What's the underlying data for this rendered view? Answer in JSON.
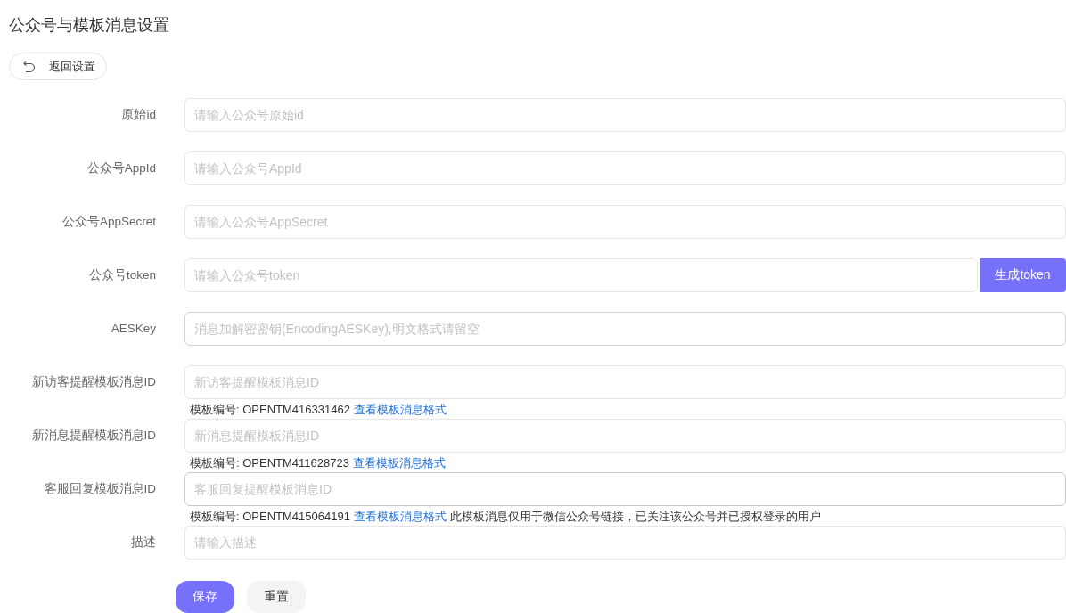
{
  "title": "公众号与模板消息设置",
  "back_button": {
    "label": "返回设置"
  },
  "fields": [
    {
      "label": "原始id",
      "placeholder": "请输入公众号原始id",
      "hovered": false,
      "focused": false
    },
    {
      "label": "公众号AppId",
      "placeholder": "请输入公众号AppId",
      "hovered": false,
      "focused": false
    },
    {
      "label": "公众号AppSecret",
      "placeholder": "请输入公众号AppSecret",
      "hovered": false,
      "focused": false
    },
    {
      "label": "公众号token",
      "placeholder": "请输入公众号token",
      "hovered": false,
      "focused": false,
      "button": "生成token"
    },
    {
      "label": "AESKey",
      "placeholder": "消息加解密密钥(EncodingAESKey),明文格式请留空",
      "hovered": true,
      "focused": false
    },
    {
      "label": "新访客提醒模板消息ID",
      "placeholder": "新访客提醒模板消息ID",
      "hovered": false,
      "focused": false,
      "hint": {
        "code": "模板编号: OPENTM416331462",
        "link": "查看模板消息格式"
      }
    },
    {
      "label": "新消息提醒模板消息ID",
      "placeholder": "新消息提醒模板消息ID",
      "hovered": false,
      "focused": false,
      "hint": {
        "code": "模板编号: OPENTM411628723",
        "link": "查看模板消息格式"
      }
    },
    {
      "label": "客服回复模板消息ID",
      "placeholder": "客服回复提醒模板消息ID",
      "hovered": false,
      "focused": true,
      "hint": {
        "code": "模板编号: OPENTM415064191",
        "link": "查看模板消息格式",
        "note": "此模板消息仅用于微信公众号链接，已关注该公众号并已授权登录的用户"
      }
    },
    {
      "label": "描述",
      "placeholder": "请输入描述",
      "hovered": false,
      "focused": false
    }
  ],
  "actions": [
    {
      "label": "保存",
      "kind": "primary"
    },
    {
      "label": "重置",
      "kind": "plain"
    }
  ]
}
